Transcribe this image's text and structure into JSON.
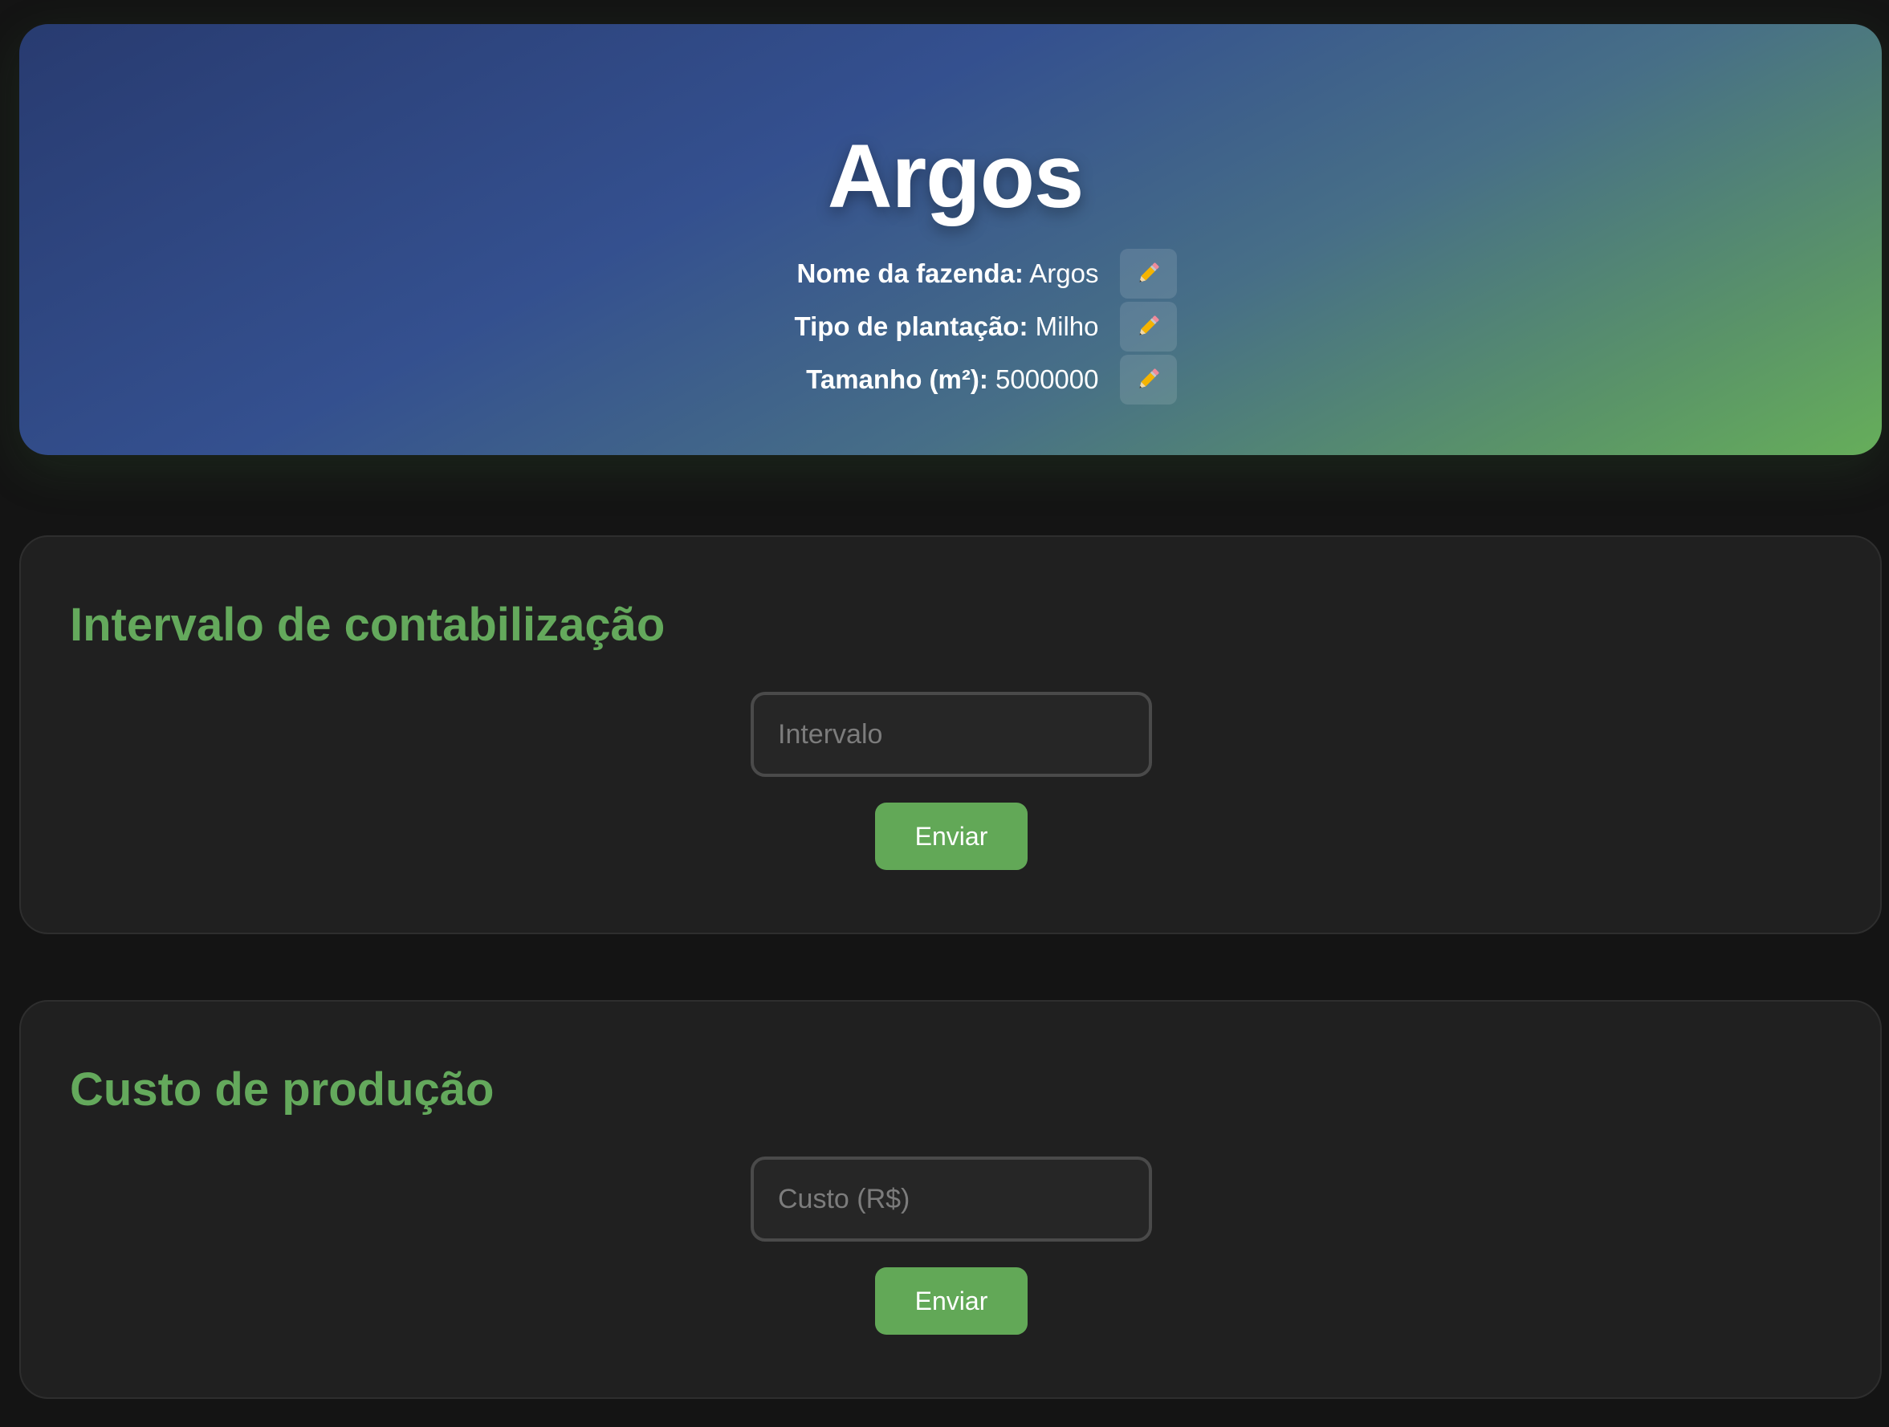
{
  "header": {
    "title": "Argos",
    "fields": [
      {
        "label": "Nome da fazenda:",
        "value": "Argos",
        "edit_icon": "pencil-icon"
      },
      {
        "label": "Tipo de plantação:",
        "value": "Milho",
        "edit_icon": "pencil-icon"
      },
      {
        "label": "Tamanho (m²):",
        "value": "5000000",
        "edit_icon": "pencil-icon"
      }
    ]
  },
  "sections": [
    {
      "title": "Intervalo de contabilização",
      "input_placeholder": "Intervalo",
      "input_value": "",
      "button_label": "Enviar"
    },
    {
      "title": "Custo de produção",
      "input_placeholder": "Custo (R$)",
      "input_value": "",
      "button_label": "Enviar"
    }
  ],
  "colors": {
    "background": "#141414",
    "accent_green": "#64a95c",
    "card": "#202020",
    "gradient_start": "#283b70",
    "gradient_end": "#66ae5a"
  }
}
